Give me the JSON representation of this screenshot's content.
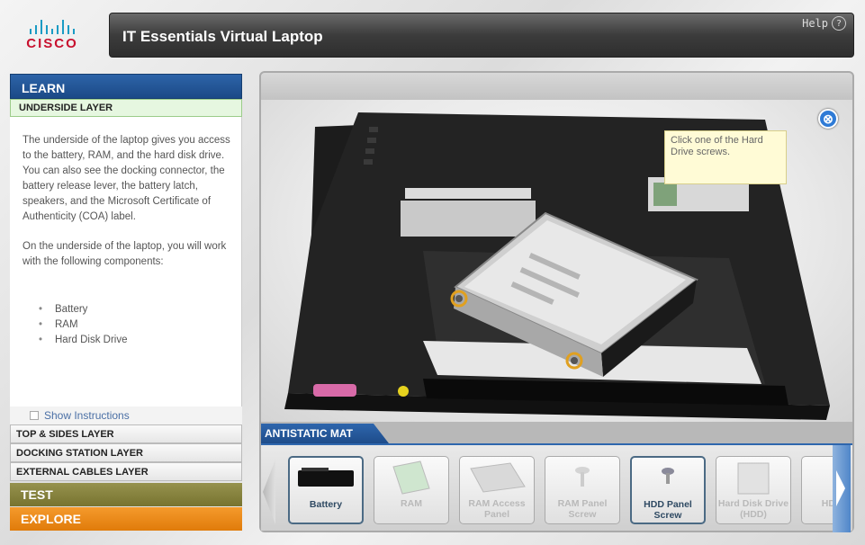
{
  "header": {
    "logo_text": "CISCO",
    "title": "IT Essentials Virtual Laptop",
    "help_label": "Help",
    "help_icon": "?"
  },
  "sidebar": {
    "learn_label": "LEARN",
    "active_layer": "UNDERSIDE LAYER",
    "description_p1": "The underside of the laptop gives you access to the battery, RAM, and the hard disk drive. You can also see the docking connector, the battery release lever, the battery latch, speakers, and the Microsoft Certificate of Authenticity (COA) label.",
    "description_p2": "On the underside of the laptop, you will work with the following components:",
    "components": [
      "Battery",
      "RAM",
      "Hard Disk Drive"
    ],
    "show_instructions": "Show Instructions",
    "layers": [
      "TOP & SIDES LAYER",
      "DOCKING STATION LAYER",
      "EXTERNAL CABLES LAYER"
    ],
    "test_label": "TEST",
    "explore_label": "EXPLORE"
  },
  "viewer": {
    "close_icon": "⊗",
    "tooltip": "Click one of the Hard Drive screws.",
    "mat_label": "ANTISTATIC MAT",
    "items": [
      {
        "label": "Battery",
        "active": true
      },
      {
        "label": "RAM",
        "active": false
      },
      {
        "label": "RAM Access Panel",
        "active": false
      },
      {
        "label": "RAM Panel Screw",
        "active": false
      },
      {
        "label": "HDD Panel Screw",
        "active": true
      },
      {
        "label": "Hard Disk Drive (HDD)",
        "active": false
      },
      {
        "label": "HDD Sc",
        "active": false
      }
    ]
  },
  "colors": {
    "learn": "#1b4a87",
    "test": "#77732f",
    "explore": "#e07b0a",
    "mat": "#1e4c8a",
    "highlight_ring": "#e0a020"
  }
}
